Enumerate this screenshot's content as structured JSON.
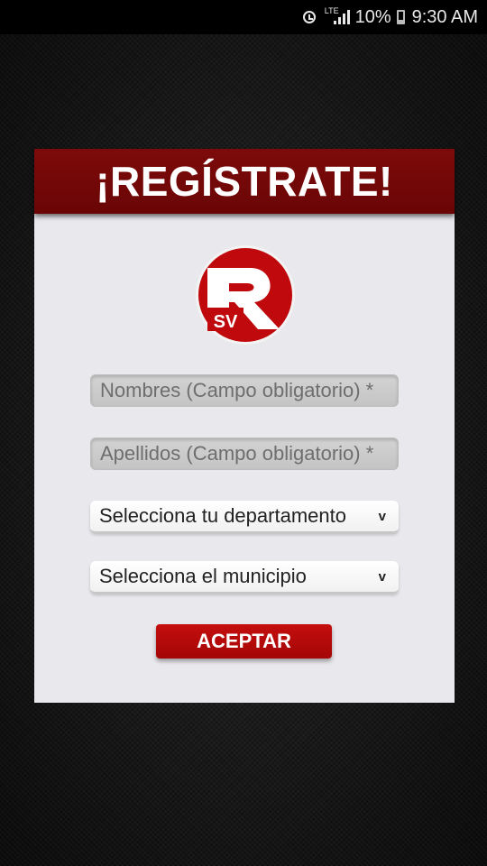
{
  "status_bar": {
    "network": "LTE",
    "battery": "10%",
    "time": "9:30 AM"
  },
  "form": {
    "title": "¡REGÍSTRATE!",
    "logo_text": "SV",
    "first_name_placeholder": "Nombres (Campo obligatorio) *",
    "last_name_placeholder": "Apellidos (Campo obligatorio) *",
    "department_select": "Selecciona tu departamento",
    "municipality_select": "Selecciona el municipio",
    "chevron": "v",
    "submit_label": "ACEPTAR"
  },
  "colors": {
    "header": "#6e0707",
    "button": "#b40909",
    "card": "#e9e8ec",
    "logo_red": "#c0090d"
  }
}
